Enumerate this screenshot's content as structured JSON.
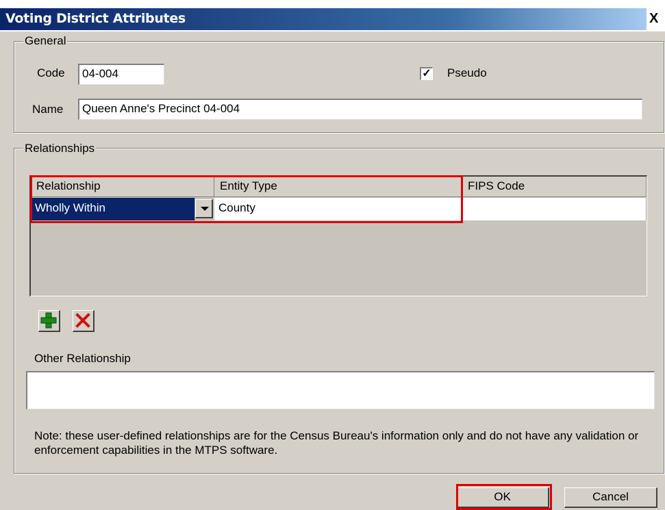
{
  "window": {
    "title": "Voting District Attributes",
    "close_glyph": "X"
  },
  "general": {
    "legend": "General",
    "code_label": "Code",
    "code_value": "04-004",
    "pseudo_label": "Pseudo",
    "pseudo_checked": true,
    "name_label": "Name",
    "name_value": "Queen Anne's Precinct 04-004"
  },
  "relationships": {
    "legend": "Relationships",
    "columns": [
      "Relationship",
      "Entity Type",
      "FIPS Code"
    ],
    "rows": [
      {
        "relationship": "Wholly Within",
        "entity_type": "County",
        "fips_code": ""
      }
    ],
    "add_icon": "plus-icon",
    "delete_icon": "x-icon",
    "other_label": "Other Relationship",
    "other_value": "",
    "note": "Note: these user-defined relationships are for the Census Bureau's information only and do not have any validation or enforcement capabilities in the MTPS software."
  },
  "buttons": {
    "ok": "OK",
    "cancel": "Cancel"
  },
  "colors": {
    "highlight": "#e00000",
    "selection": "#0a246a",
    "title_bar": "#0a246a"
  }
}
